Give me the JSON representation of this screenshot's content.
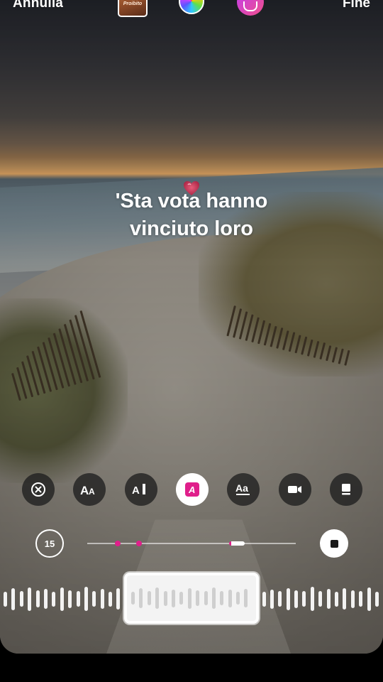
{
  "top_bar": {
    "cancel_label": "Annulla",
    "done_label": "Fine",
    "cover_text": "Proibito"
  },
  "lyric": {
    "line1": "'Sta vota hanno",
    "line2": "vinciuto loro"
  },
  "style_toolbar": {
    "tools": [
      {
        "icon": "close-circle-icon",
        "state": "inactive"
      },
      {
        "icon": "text-size-icon",
        "glyph": "AA",
        "state": "inactive"
      },
      {
        "icon": "text-cursor-icon",
        "glyph": "AI",
        "state": "inactive"
      },
      {
        "icon": "text-highlight-icon",
        "glyph": "A",
        "state": "active"
      },
      {
        "icon": "text-font-icon",
        "glyph": "Aa",
        "state": "inactive"
      },
      {
        "icon": "video-icon",
        "state": "inactive"
      },
      {
        "icon": "card-icon",
        "state": "inactive"
      }
    ],
    "accent_color": "#e01f8b"
  },
  "timeline": {
    "duration_label": "15",
    "marker_positions": [
      0.146,
      0.248
    ],
    "playhead_position": 0.68,
    "playhead_width_fraction": 0.075
  },
  "waveform": {
    "bar_heights": [
      0.28,
      0.42,
      0.3,
      0.45,
      0.32,
      0.38,
      0.28,
      0.44,
      0.34,
      0.3,
      0.46,
      0.3,
      0.38,
      0.28,
      0.4,
      0.34,
      0.3,
      0.44,
      0.28,
      0.36,
      0.3,
      0.42,
      0.34,
      0.3,
      0.46,
      0.3,
      0.38,
      0.28,
      0.4,
      0.34,
      0.3,
      0.44,
      0.28,
      0.36,
      0.3,
      0.42,
      0.34,
      0.3,
      0.46,
      0.3,
      0.38,
      0.28,
      0.4,
      0.34,
      0.3,
      0.44,
      0.28
    ],
    "window_start_fraction": 0.324,
    "window_end_fraction": 0.676
  }
}
